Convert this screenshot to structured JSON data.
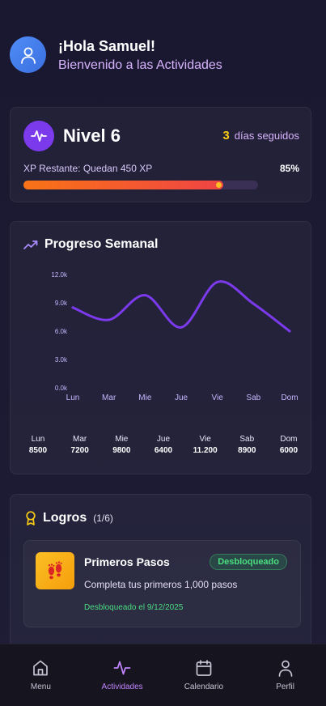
{
  "header": {
    "greeting": "¡Hola Samuel!",
    "subtitle": "Bienvenido a las Actividades"
  },
  "level": {
    "title": "Nivel 6",
    "streak_count": "3",
    "streak_label": "días seguidos",
    "xp_remaining": "XP Restante: Quedan 450 XP",
    "progress_label": "85%",
    "progress_value": 0.85,
    "bar_colors": [
      "#f97316",
      "#ef4444"
    ]
  },
  "weekly": {
    "title": "Progreso Semanal",
    "days": [
      {
        "name": "Lun",
        "value": "8500"
      },
      {
        "name": "Mar",
        "value": "7200"
      },
      {
        "name": "Mie",
        "value": "9800"
      },
      {
        "name": "Jue",
        "value": "6400"
      },
      {
        "name": "Vie",
        "value": "11.200"
      },
      {
        "name": "Sab",
        "value": "8900"
      },
      {
        "name": "Dom",
        "value": "6000"
      }
    ]
  },
  "chart_data": {
    "type": "line",
    "categories": [
      "Lun",
      "Mar",
      "Mie",
      "Jue",
      "Vie",
      "Sab",
      "Dom"
    ],
    "values": [
      8500,
      7200,
      9800,
      6400,
      11200,
      8900,
      6000
    ],
    "ylim": [
      0,
      12000
    ],
    "yticks": [
      "0.0k",
      "3.0k",
      "6.0k",
      "9.0k",
      "12.0k"
    ],
    "color": "#7c3aed",
    "grid": false
  },
  "achievements": {
    "title": "Logros",
    "count": "(1/6)",
    "items": [
      {
        "name": "Primeros Pasos",
        "status": "Desbloqueado",
        "description": "Completa tus primeros 1,000 pasos",
        "date": "Desbloqueado el 9/12/2025"
      }
    ]
  },
  "nav": {
    "items": [
      {
        "label": "Menu",
        "icon": "home-icon"
      },
      {
        "label": "Actividades",
        "icon": "activity-icon"
      },
      {
        "label": "Calendario",
        "icon": "calendar-icon"
      },
      {
        "label": "Perfil",
        "icon": "user-icon"
      }
    ],
    "active": "Actividades",
    "accent": "#c084fc"
  }
}
